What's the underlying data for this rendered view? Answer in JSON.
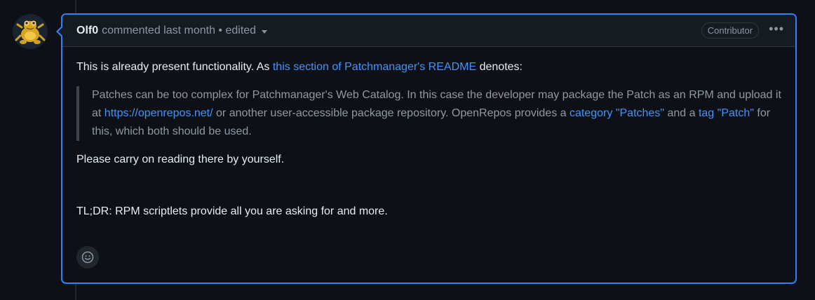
{
  "comment": {
    "author": "Olf0",
    "action": "commented",
    "timestamp": "last month",
    "edited_label": "edited",
    "badge": "Contributor",
    "menu_icon": "kebab-horizontal-icon",
    "avatar_icon": "frog-avatar",
    "body": {
      "intro_prefix": "This is already present functionality. As",
      "intro_link": "this section of Patchmanager's README",
      "intro_suffix": "denotes:",
      "quote": {
        "part1": "Patches can be too complex for Patchmanager's Web Catalog. In this case the developer may package the Patch as an RPM and upload it at",
        "link1": "https://openrepos.net/",
        "part2": "or another user-accessible package repository. OpenRepos provides a",
        "link2": "category \"Patches\"",
        "part3": "and a",
        "link3": "tag \"Patch\"",
        "part4": "for this, which both should be used."
      },
      "para2": "Please carry on reading there by yourself.",
      "para3": "TL;DR: RPM scriptlets provide all you are asking for and more."
    },
    "reaction_icon": "smiley-icon"
  },
  "colors": {
    "background": "#0d1117",
    "header": "#161b22",
    "accent": "#2f81f7",
    "link": "#4493f8",
    "muted": "#8d96a0"
  }
}
